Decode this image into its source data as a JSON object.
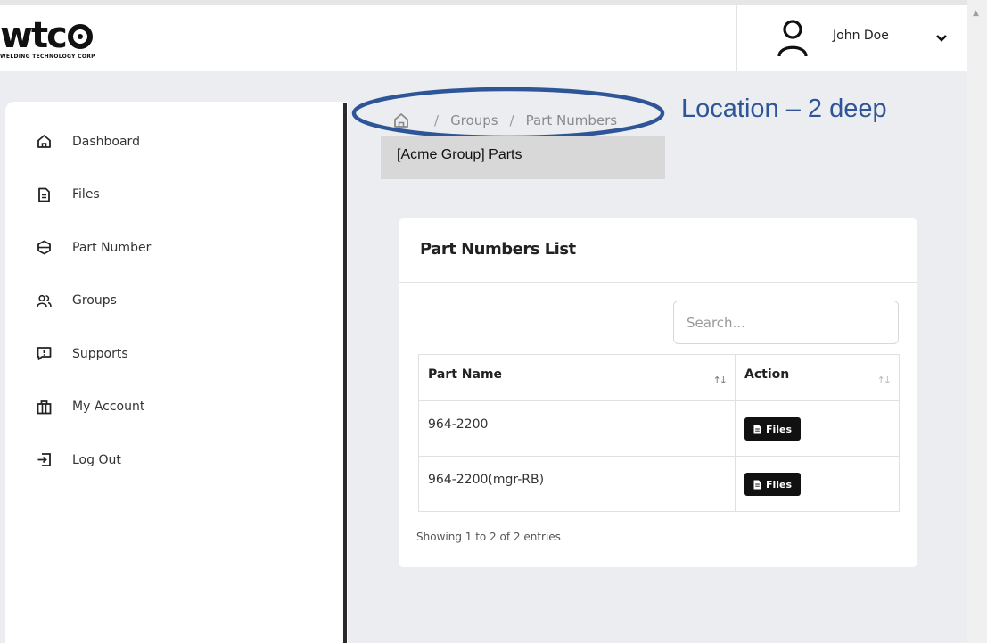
{
  "header": {
    "logo_text": "wtc",
    "logo_subtitle": "WELDING TECHNOLOGY CORP",
    "user_name": "John Doe"
  },
  "sidebar": {
    "items": [
      {
        "label": "Dashboard",
        "icon": "home-icon"
      },
      {
        "label": "Files",
        "icon": "file-icon"
      },
      {
        "label": "Part Number",
        "icon": "part-number-icon"
      },
      {
        "label": "Groups",
        "icon": "groups-icon"
      },
      {
        "label": "Supports",
        "icon": "support-icon"
      },
      {
        "label": "My Account",
        "icon": "account-icon"
      },
      {
        "label": "Log Out",
        "icon": "logout-icon"
      }
    ]
  },
  "breadcrumb": {
    "items": [
      "Groups",
      "Part Numbers"
    ],
    "separator": "/"
  },
  "annotation": "Location – 2 deep",
  "sub_label": "[Acme Group] Parts",
  "card": {
    "title": "Part Numbers List",
    "search_placeholder": "Search...",
    "columns": [
      "Part Name",
      "Action"
    ],
    "rows": [
      {
        "part_name": "964-2200",
        "action": "Files"
      },
      {
        "part_name": "964-2200(mgr-RB)",
        "action": "Files"
      }
    ],
    "footer": "Showing 1 to 2 of 2 entries"
  },
  "colors": {
    "annotation": "#2e5597",
    "button": "#111111",
    "sidebar_rule": "#2a2a2e",
    "background": "#ecedf1"
  }
}
